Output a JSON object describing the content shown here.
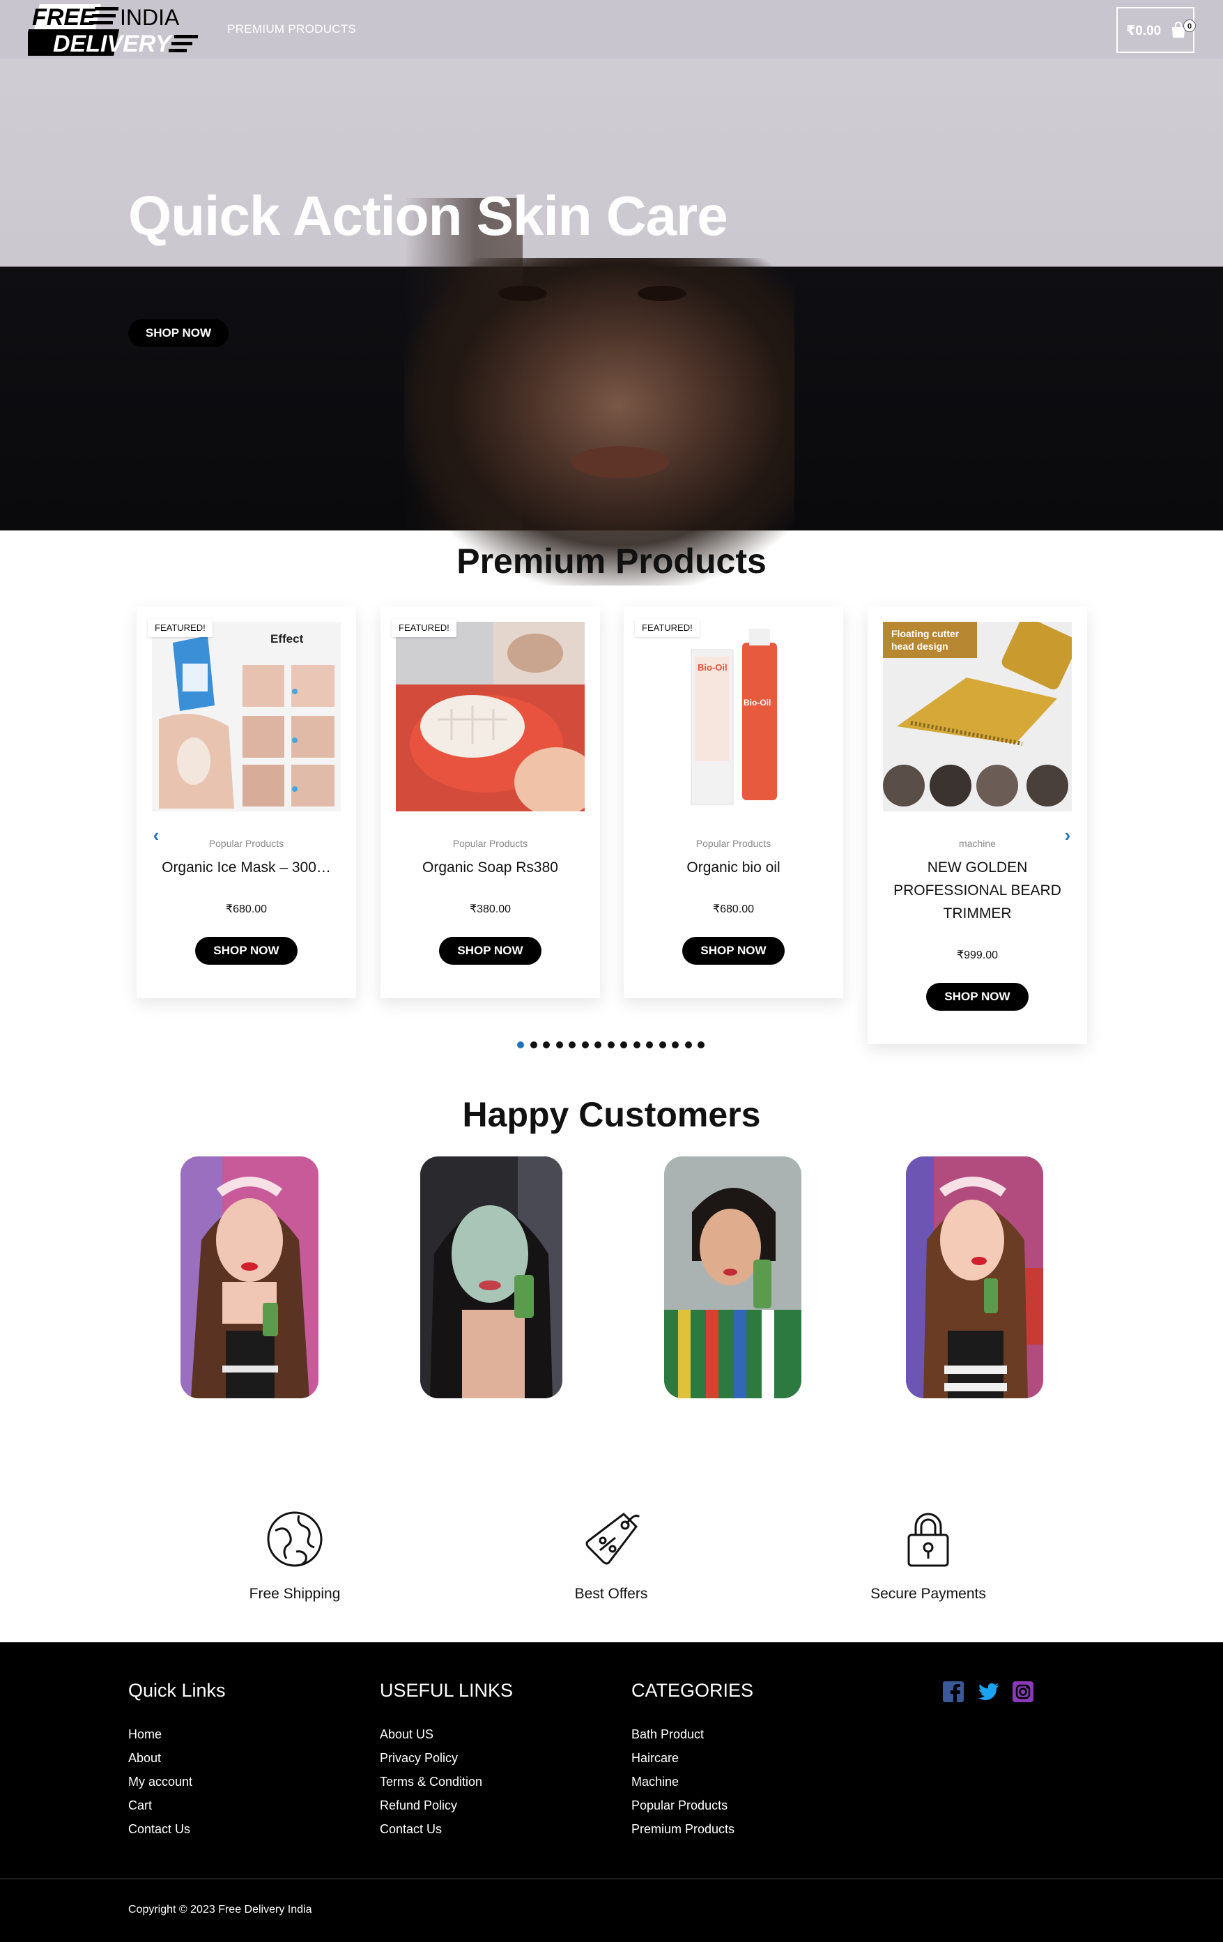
{
  "header": {
    "logo_line1_a": "FREE",
    "logo_line1_b": "INDIA",
    "logo_line2": "DELIVERY",
    "nav_premium": "PREMIUM PRODUCTS",
    "cart_amount": "₹0.00",
    "cart_count": "0",
    "cart_icon": "shopping-bag-icon"
  },
  "hero": {
    "title": "Quick Action Skin Care",
    "button": "SHOP NOW"
  },
  "premium": {
    "title": "Premium Products",
    "prev_icon": "chevron-left-icon",
    "next_icon": "chevron-right-icon",
    "cards": [
      {
        "badge": "FEATURED!",
        "category": "Popular Products",
        "name": "Organic Ice Mask – 300…",
        "price": "₹680.00",
        "button": "SHOP NOW"
      },
      {
        "badge": "FEATURED!",
        "category": "Popular Products",
        "name": "Organic Soap Rs380",
        "price": "₹380.00",
        "button": "SHOP NOW"
      },
      {
        "badge": "FEATURED!",
        "category": "Popular Products",
        "name": "Organic bio oil",
        "price": "₹680.00",
        "button": "SHOP NOW"
      },
      {
        "badge": "",
        "category": "machine",
        "name_lines": [
          "NEW GOLDEN",
          "PROFESSIONAL BEARD",
          "TRIMMER"
        ],
        "price": "₹999.00",
        "button": "SHOP NOW"
      }
    ],
    "image_texts": {
      "mask_effect": "Effect",
      "bio_oil_a": "Bio-Oil",
      "bio_oil_b": "Bio-Oil",
      "trimmer_banner_1": "Floating cutter",
      "trimmer_banner_2": "head design"
    },
    "pagination": {
      "total_dots": 15,
      "active_index": 0
    }
  },
  "customers": {
    "title": "Happy Customers"
  },
  "features": [
    {
      "label": "Free Shipping",
      "icon": "globe-icon"
    },
    {
      "label": "Best Offers",
      "icon": "price-tag-icon"
    },
    {
      "label": "Secure Payments",
      "icon": "padlock-icon"
    }
  ],
  "footer": {
    "quick_links": {
      "title": "Quick Links",
      "items": [
        "Home",
        "About",
        "My account",
        "Cart",
        "Contact Us"
      ]
    },
    "useful_links": {
      "title": "USEFUL LINKS",
      "items": [
        "About US",
        "Privacy Policy",
        "Terms & Condition",
        "Refund Policy",
        "Contact Us"
      ]
    },
    "categories": {
      "title": "CATEGORIES",
      "items": [
        "Bath Product",
        "Haircare",
        "Machine",
        "Popular Products",
        "Premium Products"
      ]
    },
    "social": [
      {
        "icon": "facebook-icon",
        "color": "#3b5998"
      },
      {
        "icon": "twitter-icon",
        "color": "#1da1f2"
      },
      {
        "icon": "instagram-icon",
        "color": "#8a3ab9"
      }
    ],
    "copyright": "Copyright © 2023 Free Delivery India"
  },
  "colors": {
    "header_bg": "#c9c5ce",
    "accent_blue": "#1e73be",
    "button_bg": "#000000",
    "footer_bg": "#000000"
  }
}
